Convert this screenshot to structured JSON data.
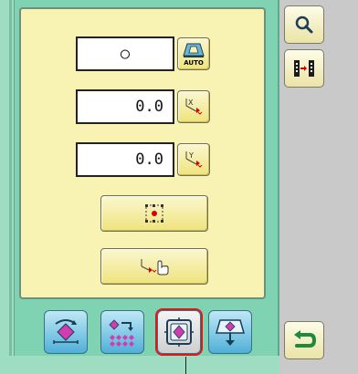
{
  "fields": {
    "scale_value": "○",
    "x_value": "0.0",
    "y_value": "0.0"
  },
  "buttons": {
    "auto_label": "AUTO",
    "x_move_label": "X",
    "y_move_label": "Y"
  },
  "colors": {
    "accent_red": "#d40000",
    "tab_blue": "#4fb0d8",
    "selected_outline": "#e01818"
  },
  "icons": {
    "zoom": "magnifier-icon",
    "trace": "trace-icon",
    "return": "return-arrow-icon"
  }
}
